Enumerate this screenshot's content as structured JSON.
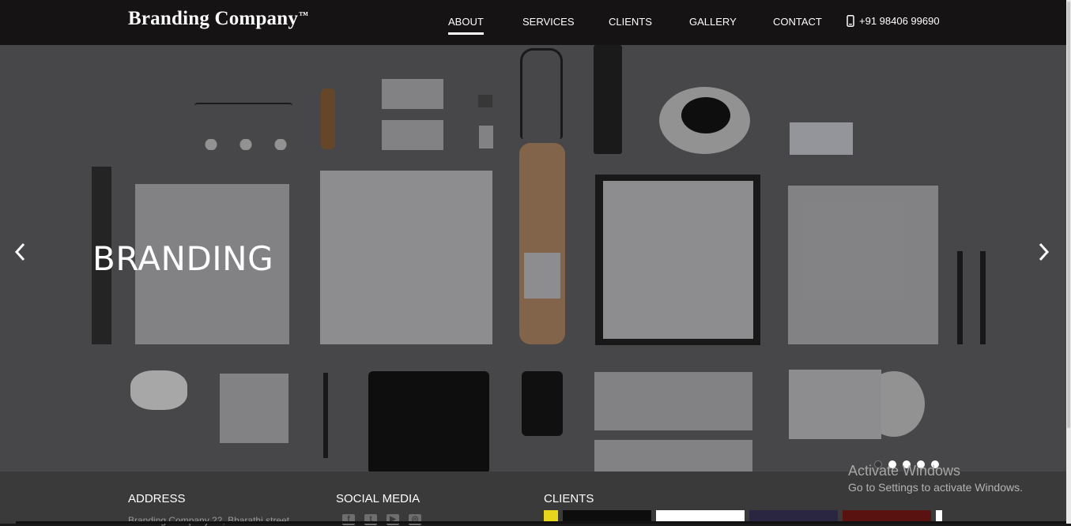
{
  "header": {
    "brand": "Branding Company",
    "brand_tm": "™",
    "nav": [
      {
        "label": "ABOUT",
        "active": true
      },
      {
        "label": "SERVICES",
        "active": false
      },
      {
        "label": "CLIENTS",
        "active": false
      },
      {
        "label": "GALLERY",
        "active": false
      },
      {
        "label": "CONTACT",
        "active": false
      }
    ],
    "phone": "+91 98406 99690",
    "phone_icon": "mobile-phone-icon"
  },
  "hero": {
    "title": "BRANDING",
    "prev_icon": "chevron-left-icon",
    "next_icon": "chevron-right-icon",
    "slide_count": 5,
    "active_slide": 1
  },
  "footer": {
    "address_heading": "ADDRESS",
    "address_text": "Branding Company 22, Bharathi street",
    "social_heading": "SOCIAL MEDIA",
    "social_icons": [
      "facebook-icon",
      "twitter-icon",
      "youtube-icon",
      "instagram-icon"
    ],
    "clients_heading": "CLIENTS"
  },
  "system": {
    "activate_title": "Activate Windows",
    "activate_sub": "Go to Settings to activate Windows."
  },
  "colors": {
    "topbar": "#151313",
    "hero_bg": "#4b4b4d",
    "footer_bg": "#3a3a3a",
    "text": "#ffffff"
  }
}
